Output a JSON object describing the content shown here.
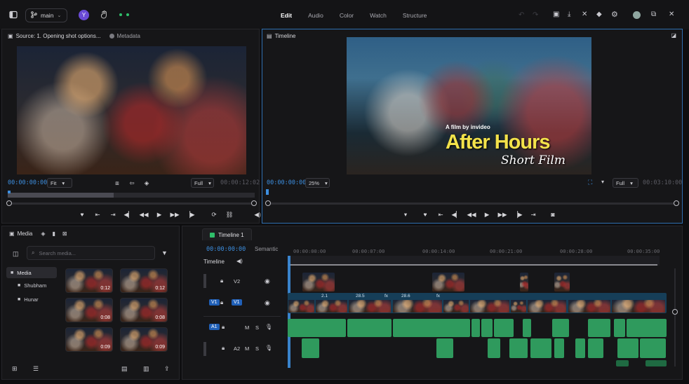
{
  "topbar": {
    "branch_label": "main",
    "avatar_letter": "Y",
    "tabs": [
      "Edit",
      "Audio",
      "Color",
      "Watch",
      "Structure"
    ],
    "active_tab": "Edit"
  },
  "source": {
    "title": "Source: 1. Opening shot options...",
    "metadata_label": "Metadata",
    "timecode": "00:00:00:00",
    "fit": "Fit",
    "zoom": "Full",
    "duration": "00:00:12:02",
    "progress": 0.43
  },
  "program": {
    "title": "Timeline",
    "timecode": "00:00:00:00",
    "zoom_pct": "25%",
    "zoom": "Full",
    "duration": "00:03:10:00",
    "overlay_small": "A film by invideo",
    "overlay_big": "After Hours",
    "overlay_sub": "Short Film"
  },
  "media": {
    "title": "Media",
    "search_placeholder": "Search media...",
    "folders": [
      "Media",
      "Shubham",
      "Hunar"
    ],
    "active_folder": "Media",
    "thumbs": [
      {
        "duration": "0:12"
      },
      {
        "duration": "0:12"
      },
      {
        "duration": "0:08"
      },
      {
        "duration": "0:08"
      },
      {
        "duration": "0:09"
      },
      {
        "duration": "0:09"
      }
    ]
  },
  "timeline": {
    "tab_label": "Timeline 1",
    "timecode": "00:00:00:00",
    "semantic_label": "Semantic",
    "header_label": "Timeline",
    "ruler": [
      "00:00:00:00",
      "00:00:07:00",
      "00:00:14:00",
      "00:00:21:00",
      "00:00:28:00",
      "00:00:35:00"
    ],
    "tracks": [
      {
        "id": "V2",
        "label": "V2"
      },
      {
        "id": "V1",
        "label": "V1",
        "badge": "V1"
      },
      {
        "id": "A1",
        "label": "A1",
        "badge": "A1",
        "m": "M",
        "s": "S"
      },
      {
        "id": "A2",
        "label": "A2",
        "m": "M",
        "s": "S"
      }
    ],
    "clip_labels": [
      "2.1",
      "28.5",
      "28.6",
      "fx",
      "fx"
    ]
  }
}
